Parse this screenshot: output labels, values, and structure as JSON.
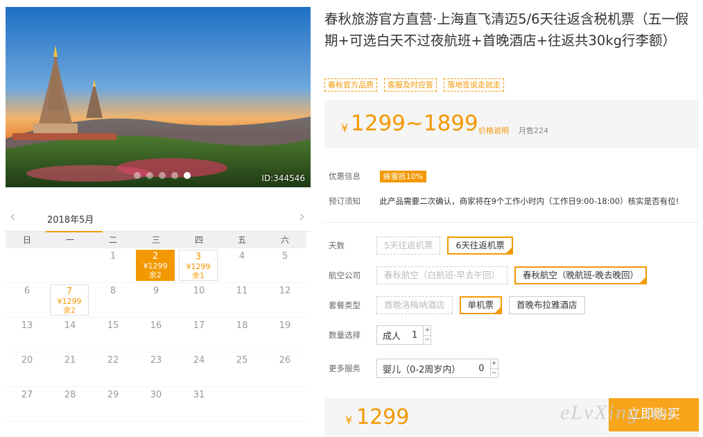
{
  "hero": {
    "id_label": "ID:344546",
    "dots": 5,
    "active_dot": 4
  },
  "calendar": {
    "month": "2018年5月",
    "weekdays": [
      "日",
      "一",
      "二",
      "三",
      "四",
      "五",
      "六"
    ],
    "cells": [
      {
        "d": ""
      },
      {
        "d": ""
      },
      {
        "d": "1"
      },
      {
        "d": "2",
        "p": "¥1299",
        "r": "余2",
        "state": "sel"
      },
      {
        "d": "3",
        "p": "¥1299",
        "r": "余1",
        "state": "avail"
      },
      {
        "d": "4"
      },
      {
        "d": "5"
      },
      {
        "d": "6"
      },
      {
        "d": "7",
        "p": "¥1299",
        "r": "余2",
        "state": "avail"
      },
      {
        "d": "8"
      },
      {
        "d": "9"
      },
      {
        "d": "10"
      },
      {
        "d": "11"
      },
      {
        "d": "12"
      },
      {
        "d": "13"
      },
      {
        "d": "14"
      },
      {
        "d": "15"
      },
      {
        "d": "16"
      },
      {
        "d": "17"
      },
      {
        "d": "18"
      },
      {
        "d": "19"
      },
      {
        "d": "20"
      },
      {
        "d": "21"
      },
      {
        "d": "22"
      },
      {
        "d": "23"
      },
      {
        "d": "24"
      },
      {
        "d": "25"
      },
      {
        "d": "26"
      },
      {
        "d": "27"
      },
      {
        "d": "28"
      },
      {
        "d": "29"
      },
      {
        "d": "30"
      },
      {
        "d": "31"
      },
      {
        "d": ""
      },
      {
        "d": ""
      }
    ]
  },
  "product": {
    "title": "春秋旅游官方直营·上海直飞清迈5/6天往返含税机票（五一假期+可选白天不过夜航班+首晚酒店+往返共30kg行李额）",
    "tags": [
      "春秋官方品质",
      "客服及时应答",
      "落地签说走就走"
    ],
    "price_currency": "¥",
    "price_range": "1299~1899",
    "price_note": "价格说明",
    "monthly_sales": "月售224"
  },
  "info": {
    "promo_label": "优惠信息",
    "promo_badge": "蜂蜜抵10%",
    "notice_label": "预订须知",
    "notice_text": "此产品需要二次确认，商家将在9个工作小时内（工作日9:00-18:00）核实是否有位!"
  },
  "options": {
    "days": {
      "label": "天数",
      "items": [
        {
          "text": "5天往返机票",
          "state": "dis"
        },
        {
          "text": "6天往返机票",
          "state": "on"
        }
      ]
    },
    "airline": {
      "label": "航空公司",
      "items": [
        {
          "text": "春秋航空（白航班-早去午回）",
          "state": "dis"
        },
        {
          "text": "春秋航空（晚航班-晚去晚回）",
          "state": "on"
        }
      ]
    },
    "package": {
      "label": "套餐类型",
      "items": [
        {
          "text": "首晚洛梅纳酒店",
          "state": "dis"
        },
        {
          "text": "单机票",
          "state": "on"
        },
        {
          "text": "首晚布拉雅酒店",
          "state": "norm"
        }
      ]
    },
    "quantity": {
      "label": "数量选择",
      "type": "成人",
      "value": "1",
      "plus": "+",
      "minus": "−"
    },
    "more": {
      "label": "更多服务",
      "type": "婴儿（0-2周岁内）",
      "value": "0",
      "plus": "+",
      "minus": "−"
    }
  },
  "buy": {
    "currency": "¥",
    "price": "1299",
    "button": "立即购买"
  },
  "watermark": "eLvXing.net",
  "colors": {
    "accent": "#f39800",
    "button": "#f7a51a"
  }
}
